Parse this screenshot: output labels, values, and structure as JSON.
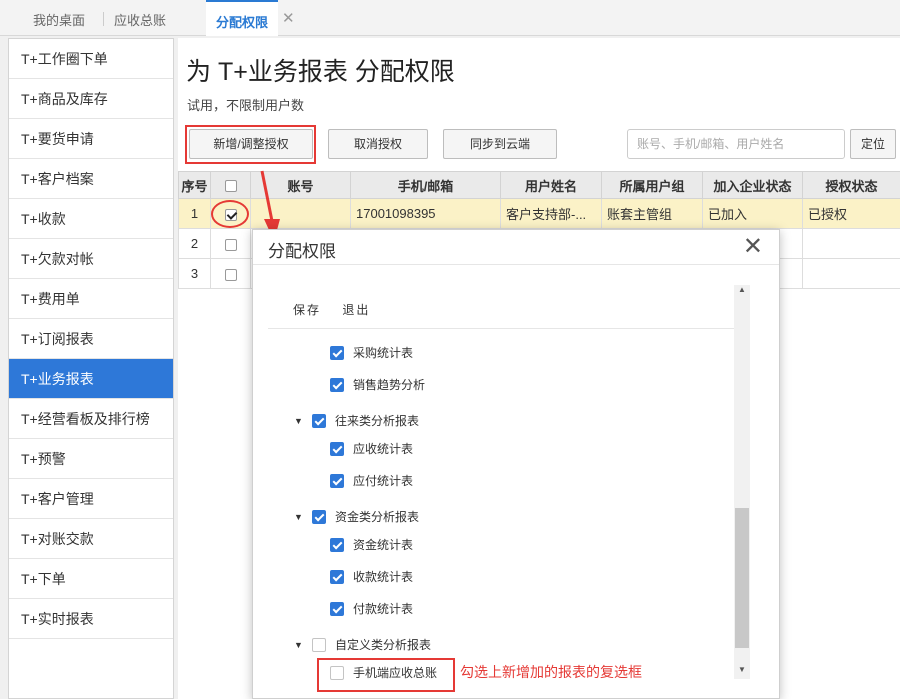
{
  "tabs": [
    "我的桌面",
    "应收总账",
    "分配权限"
  ],
  "tab_close": "✕",
  "sidebar": {
    "items": [
      "T+工作圈下单",
      "T+商品及库存",
      "T+要货申请",
      "T+客户档案",
      "T+收款",
      "T+欠款对帐",
      "T+费用单",
      "T+订阅报表",
      "T+业务报表",
      "T+经营看板及排行榜",
      "T+预警",
      "T+客户管理",
      "T+对账交款",
      "T+下单",
      "T+实时报表"
    ],
    "active_index": 8
  },
  "page": {
    "title": "为 T+业务报表 分配权限",
    "subtitle": "试用，不限制用户数"
  },
  "toolbar": {
    "add_adjust": "新增/调整授权",
    "cancel_auth": "取消授权",
    "sync_cloud": "同步到云端",
    "search_placeholder": "账号、手机/邮箱、用户姓名",
    "locate": "定位"
  },
  "table": {
    "headers": [
      "序号",
      "",
      "账号",
      "手机/邮箱",
      "用户姓名",
      "所属用户组",
      "加入企业状态",
      "授权状态"
    ],
    "rows": [
      {
        "no": "1",
        "checked": true,
        "account": "",
        "phone": "17001098395",
        "name": "客户支持部-...",
        "group": "账套主管组",
        "join": "已加入",
        "auth": "已授权"
      },
      {
        "no": "2",
        "checked": false,
        "account": "",
        "phone": "",
        "name": "",
        "group": "",
        "join": "",
        "auth": ""
      },
      {
        "no": "3",
        "checked": false,
        "account": "",
        "phone": "",
        "name": "",
        "group": "",
        "join": "",
        "auth": ""
      }
    ]
  },
  "dialog": {
    "title": "分配权限",
    "close": "✕",
    "save": "保存",
    "exit": "退出",
    "tree": [
      {
        "label": "采购统计表",
        "checked": true,
        "level": 2
      },
      {
        "label": "销售趋势分析",
        "checked": true,
        "level": 2
      },
      {
        "label": "往来类分析报表",
        "checked": true,
        "level": 1
      },
      {
        "label": "应收统计表",
        "checked": true,
        "level": 2
      },
      {
        "label": "应付统计表",
        "checked": true,
        "level": 2
      },
      {
        "label": "资金类分析报表",
        "checked": true,
        "level": 1
      },
      {
        "label": "资金统计表",
        "checked": true,
        "level": 2
      },
      {
        "label": "收款统计表",
        "checked": true,
        "level": 2
      },
      {
        "label": "付款统计表",
        "checked": true,
        "level": 2
      },
      {
        "label": "自定义类分析报表",
        "checked": false,
        "level": 1
      },
      {
        "label": "手机端应收总账",
        "checked": false,
        "level": 2
      }
    ]
  },
  "annotation": "勾选上新增加的报表的复选框",
  "colors": {
    "accent": "#2e78d8",
    "highlight": "#e53935",
    "selected_row": "#fbf2c7"
  }
}
